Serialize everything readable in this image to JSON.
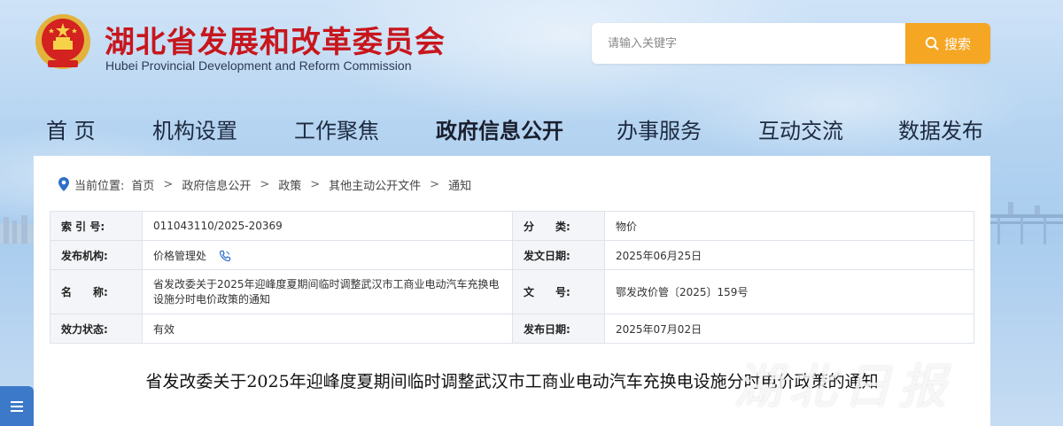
{
  "header": {
    "title_cn": "湖北省发展和改革委员会",
    "title_en": "Hubei Provincial Development and Reform Commission",
    "emblem_icon": "national-emblem-icon"
  },
  "search": {
    "placeholder": "请输入关键字",
    "button_label": "搜索",
    "button_color": "#f5a623"
  },
  "nav": {
    "items": [
      {
        "label": "首 页"
      },
      {
        "label": "机构设置"
      },
      {
        "label": "工作聚焦"
      },
      {
        "label": "政府信息公开",
        "active": true
      },
      {
        "label": "办事服务"
      },
      {
        "label": "互动交流"
      },
      {
        "label": "数据发布"
      }
    ]
  },
  "breadcrumb": {
    "prefix": "当前位置:",
    "items": [
      "首页",
      "政府信息公开",
      "政策",
      "其他主动公开文件",
      "通知"
    ],
    "separator": ">"
  },
  "meta": {
    "index_label": "索 引 号:",
    "index_value": "011043110/2025-20369",
    "category_label": "分　　类:",
    "category_value": "物价",
    "publisher_label": "发布机构:",
    "publisher_value": "价格管理处",
    "doc_date_label": "发文日期:",
    "doc_date_value": "2025年06月25日",
    "name_label": "名　　称:",
    "name_value": "省发改委关于2025年迎峰度夏期间临时调整武汉市工商业电动汽车充换电设施分时电价政策的通知",
    "doc_no_label": "文　　号:",
    "doc_no_value": "鄂发改价管〔2025〕159号",
    "status_label": "效力状态:",
    "status_value": "有效",
    "pub_date_label": "发布日期:",
    "pub_date_value": "2025年07月02日"
  },
  "document": {
    "title": "省发改委关于2025年迎峰度夏期间临时调整武汉市工商业电动汽车充换电设施分时电价政策的通知"
  },
  "watermark": "湖北日报",
  "colors": {
    "brand_red": "#c8161d",
    "accent_orange": "#f5a623",
    "side_tool_blue": "#3d79c9"
  }
}
